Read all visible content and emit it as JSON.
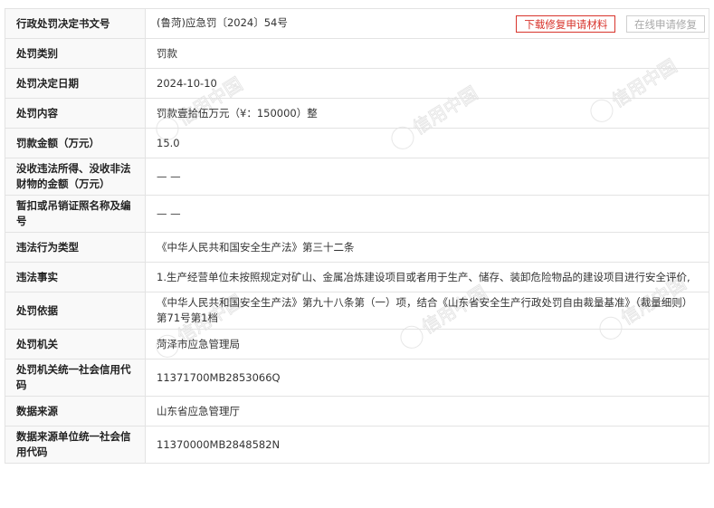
{
  "rows": [
    {
      "label": "行政处罚决定书文号",
      "value": "(鲁菏)应急罚〔2024〕54号",
      "buttons": [
        "下载修复申请材料",
        "在线申请修复"
      ]
    },
    {
      "label": "处罚类别",
      "value": "罚款"
    },
    {
      "label": "处罚决定日期",
      "value": "2024-10-10"
    },
    {
      "label": "处罚内容",
      "value": "罚款壹拾伍万元（¥：150000）整"
    },
    {
      "label": "罚款金额（万元）",
      "value": "15.0"
    },
    {
      "label": "没收违法所得、没收非法财物的金额（万元）",
      "value": "— —"
    },
    {
      "label": "暂扣或吊销证照名称及编号",
      "value": "— —"
    },
    {
      "label": "违法行为类型",
      "value": "《中华人民共和国安全生产法》第三十二条"
    },
    {
      "label": "违法事实",
      "value": "1.生产经营单位未按照规定对矿山、金属冶炼建设项目或者用于生产、储存、装卸危险物品的建设项目进行安全评价,"
    },
    {
      "label": "处罚依据",
      "value": "《中华人民共和国安全生产法》第九十八条第（一）项，结合《山东省安全生产行政处罚自由裁量基准》（裁量细则）第71号第1档"
    },
    {
      "label": "处罚机关",
      "value": "菏泽市应急管理局"
    },
    {
      "label": "处罚机关统一社会信用代码",
      "value": "11371700MB2853066Q"
    },
    {
      "label": "数据来源",
      "value": "山东省应急管理厅"
    },
    {
      "label": "数据来源单位统一社会信用代码",
      "value": "11370000MB2848582N"
    }
  ],
  "watermark": {
    "text": "信用中国"
  },
  "colors": {
    "accent": "#d8342c",
    "border": "#e3e3e3",
    "label_bg": "#f8f8f8"
  }
}
